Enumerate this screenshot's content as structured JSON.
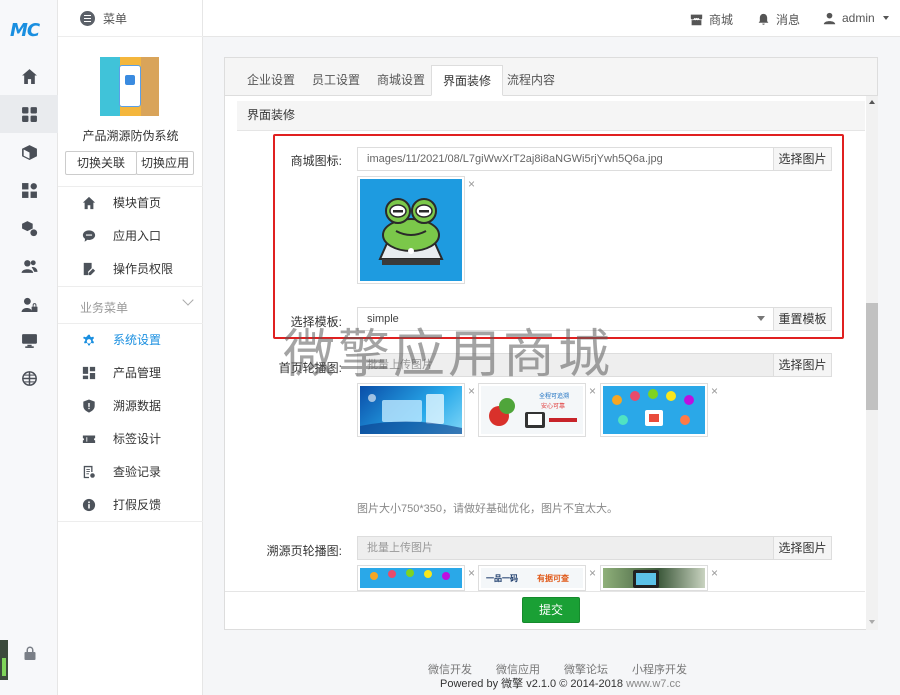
{
  "brand": {
    "logo_text": "MC"
  },
  "topbar": {
    "menu_label": "菜单",
    "shop_label": "商城",
    "message_label": "消息",
    "user_label": "admin"
  },
  "sidebar": {
    "app_name": "产品溯源防伪系统",
    "switch_relation": "切换关联",
    "switch_app": "切换应用",
    "items": [
      {
        "label": "模块首页",
        "icon": "home-icon"
      },
      {
        "label": "应用入口",
        "icon": "chat-icon"
      },
      {
        "label": "操作员权限",
        "icon": "edit-doc-icon"
      }
    ],
    "section_label": "业务菜单",
    "business_items": [
      {
        "label": "系统设置",
        "icon": "gear-icon",
        "active": true
      },
      {
        "label": "产品管理",
        "icon": "grid-icon"
      },
      {
        "label": "溯源数据",
        "icon": "shield-icon"
      },
      {
        "label": "标签设计",
        "icon": "ticket-icon"
      },
      {
        "label": "查验记录",
        "icon": "list-icon"
      },
      {
        "label": "打假反馈",
        "icon": "info-icon"
      }
    ]
  },
  "tabs": [
    {
      "label": "企业设置"
    },
    {
      "label": "员工设置"
    },
    {
      "label": "商城设置"
    },
    {
      "label": "界面装修",
      "active": true
    },
    {
      "label": "流程内容"
    }
  ],
  "section_title": "界面装修",
  "form": {
    "shop_icon_label": "商城图标:",
    "shop_icon_value": "images/11/2021/08/L7giWwXrT2aj8i8aNGWi5rjYwh5Q6a.jpg",
    "select_image": "选择图片",
    "template_label": "选择模板:",
    "template_value": "simple",
    "reset_template": "重置模板",
    "home_carousel_label": "首页轮播图:",
    "batch_upload_placeholder": "批量上传图片",
    "image_hint": "图片大小750*350，请做好基础优化，图片不宜太大。",
    "trace_carousel_label": "溯源页轮播图:",
    "remove_mark": "×",
    "submit": "提交"
  },
  "thumb_texts": {
    "home2_line1": "全程可追溯",
    "home2_line2": "安心可靠",
    "trace2_line1": "一品一码",
    "trace2_line2": "有据可查"
  },
  "watermark": "微擎应用商城",
  "footer": {
    "links": [
      "微信开发",
      "微信应用",
      "微擎论坛",
      "小程序开发"
    ],
    "powered": "Powered by 微擎 v2.1.0 © 2014-2018",
    "site": "www.w7.cc"
  },
  "colors": {
    "accent": "#1a8fe0",
    "submit": "#1aa035",
    "highlight": "#e02020"
  }
}
